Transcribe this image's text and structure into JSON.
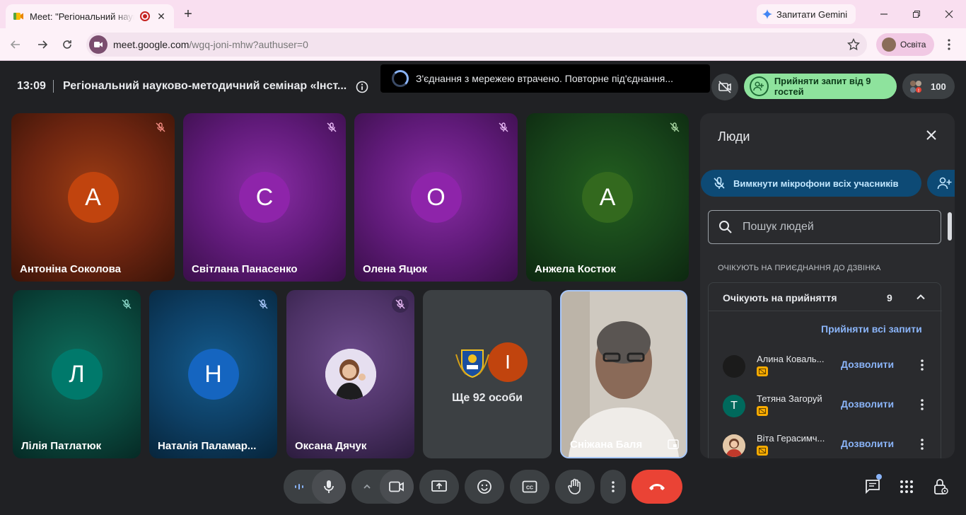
{
  "browser": {
    "tab_title": "Meet: \"Регіональний науко",
    "gemini_label": "Запитати Gemini",
    "url_host": "meet.google.com",
    "url_path": "/wgq-joni-mhw?authuser=0",
    "profile_label": "Освіта"
  },
  "meet": {
    "time": "13:09",
    "title": "Регіональний науково-методичний семінар «Інст...",
    "toast": "З'єднання з мережею втрачено. Повторне під'єднання...",
    "admit_pill": "Прийняти запит від 9 гостей",
    "participant_count": "100"
  },
  "tiles": [
    {
      "initial": "А",
      "name": "Антоніна Соколова",
      "color": "#c1440e"
    },
    {
      "initial": "С",
      "name": "Світлана Панасенко",
      "color": "#8e24aa"
    },
    {
      "initial": "О",
      "name": "Олена Яцюк",
      "color": "#8e24aa"
    },
    {
      "initial": "А",
      "name": "Анжела Костюк",
      "color": "#33691e"
    },
    {
      "initial": "Л",
      "name": "Лілія Патлатюк",
      "color": "#00796b"
    },
    {
      "initial": "Н",
      "name": "Наталія Паламар...",
      "color": "#1565c0"
    },
    {
      "name": "Оксана Дячук"
    },
    {
      "initial": "І",
      "more_text": "Ще 92 особи",
      "color": "#c1440e"
    },
    {
      "name": "Сніжана Баля"
    }
  ],
  "panel": {
    "title": "Люди",
    "mute_all": "Вимкнути мікрофони всіх учасників",
    "search_placeholder": "Пошук людей",
    "section": "ОЧІКУЮТЬ НА ПРИЄДНАННЯ ДО ДЗВІНКА",
    "waiting_header": "Очікують на прийняття",
    "waiting_count": "9",
    "admit_all": "Прийняти всі запити",
    "waiting": [
      {
        "name": "Алина Коваль...",
        "allow": "Дозволити",
        "color": "#1b1b1b",
        "initial": ""
      },
      {
        "name": "Тетяна Загоруй",
        "allow": "Дозволити",
        "color": "#00695c",
        "initial": "Т"
      },
      {
        "name": "Віта Герасимч...",
        "allow": "Дозволити",
        "color": "#d9a77b",
        "initial": ""
      }
    ]
  },
  "icons": [
    "mic-off-icon",
    "info-icon",
    "spinner-icon",
    "camera-off-icon",
    "person-add-icon",
    "people-icon",
    "close-icon",
    "search-icon",
    "chevron-up-icon",
    "more-vert-icon",
    "mic-icon",
    "camera-icon",
    "present-icon",
    "emoji-icon",
    "captions-icon",
    "hand-icon",
    "call-end-icon",
    "chat-icon",
    "apps-icon",
    "host-controls-icon"
  ],
  "colors": {
    "accent": "#8ab4f8",
    "admit": "#8ee39d",
    "hangup": "#ea4335",
    "panel": "#2a2b2e",
    "background": "#202124"
  }
}
